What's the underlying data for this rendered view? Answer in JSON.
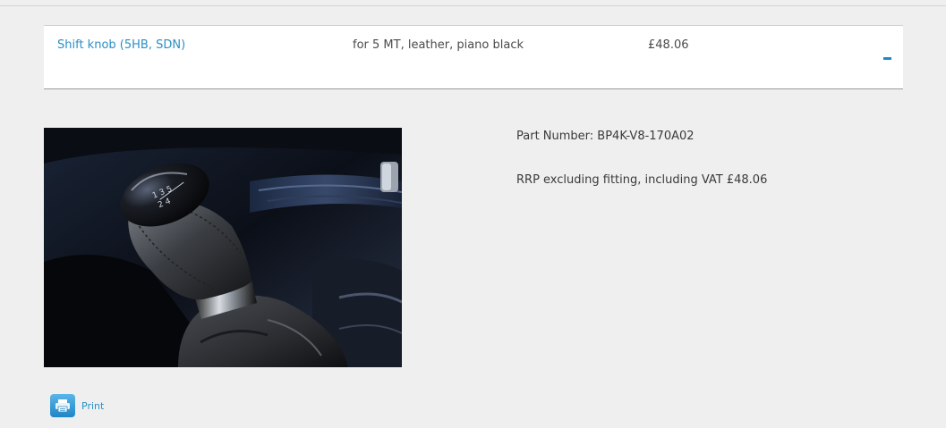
{
  "accessory_row": {
    "name": "Shift knob (5HB, SDN)",
    "description": "for 5 MT, leather, piano black",
    "price": "£48.06",
    "toggle_label": "-"
  },
  "details": {
    "part_number": "Part Number: BP4K-V8-170A02",
    "rrp": "RRP excluding fitting, including VAT £48.06"
  },
  "image": {
    "subject": "leather gear shift knob with piano black top",
    "gear_pattern_text": "1 3 5 2 4"
  },
  "actions": {
    "print_label": "Print",
    "print_icon": "printer-icon"
  },
  "colors": {
    "link": "#2a8fc6",
    "accent": "#1d8bc7",
    "background": "#efefef"
  }
}
